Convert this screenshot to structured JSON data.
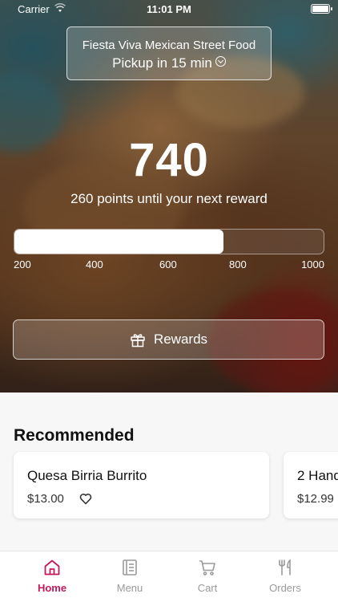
{
  "status_bar": {
    "carrier": "Carrier",
    "time": "11:01 PM"
  },
  "store": {
    "name": "Fiesta Viva Mexican Street Food",
    "pickup": "Pickup in 15 min"
  },
  "rewards": {
    "points": "740",
    "subtitle": "260 points until your next reward",
    "progress_min": 200,
    "progress_max": 1000,
    "progress_value": 740,
    "ticks": [
      "200",
      "400",
      "600",
      "800",
      "1000"
    ],
    "button_label": "Rewards"
  },
  "recommended": {
    "title": "Recommended",
    "items": [
      {
        "name": "Quesa Birria Burrito",
        "price": "$13.00"
      },
      {
        "name": "2 Hand",
        "price": "$12.99"
      }
    ]
  },
  "tabs": [
    {
      "label": "Home",
      "icon": "home-icon",
      "active": true
    },
    {
      "label": "Menu",
      "icon": "menu-icon",
      "active": false
    },
    {
      "label": "Cart",
      "icon": "cart-icon",
      "active": false
    },
    {
      "label": "Orders",
      "icon": "orders-icon",
      "active": false
    }
  ],
  "colors": {
    "accent": "#c21a5a"
  }
}
